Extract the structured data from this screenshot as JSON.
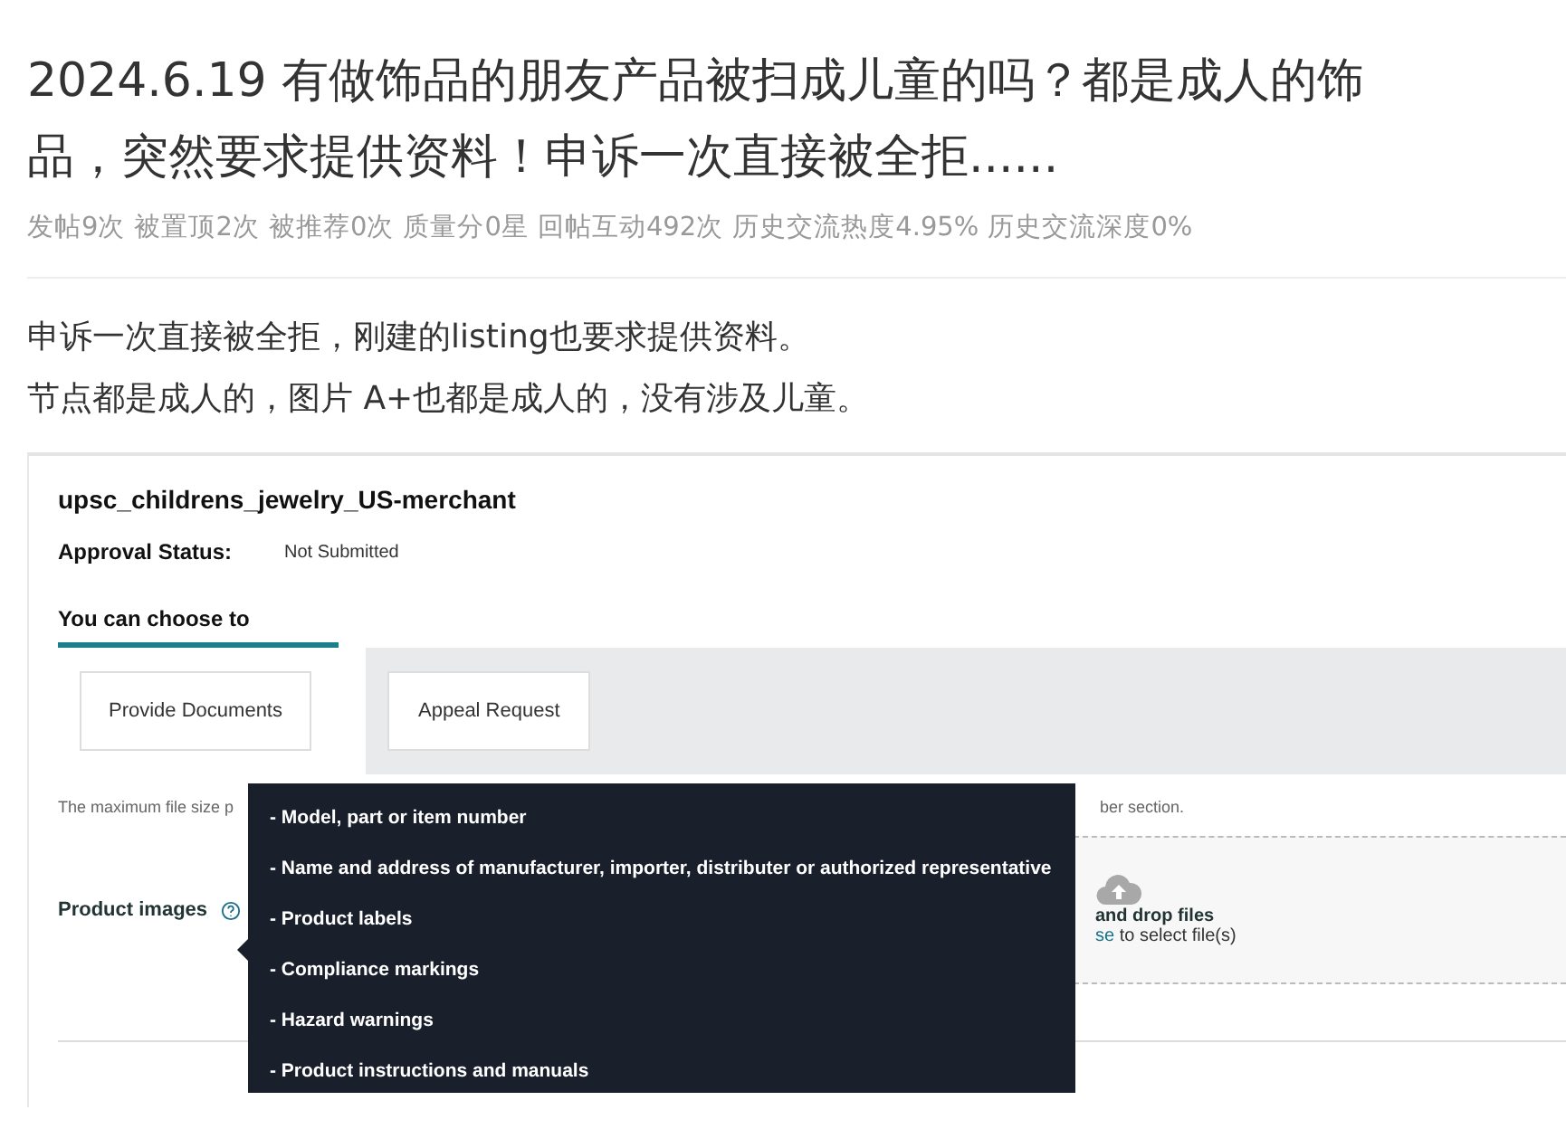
{
  "post": {
    "title": "2024.6.19 有做饰品的朋友产品被扫成儿童的吗？都是成人的饰品，突然要求提供资料！申诉一次直接被全拒......",
    "stats": [
      "发帖9次",
      "被置顶2次",
      "被推荐0次",
      "质量分0星",
      "回帖互动492次",
      "历史交流热度4.95%",
      "历史交流深度0%"
    ],
    "body": [
      "申诉一次直接被全拒，刚建的listing也要求提供资料。",
      "节点都是成人的，图片 A+也都是成人的，没有涉及儿童。"
    ]
  },
  "screenshot": {
    "title": "upsc_childrens_jewelry_US-merchant",
    "approval_label": "Approval Status:",
    "approval_value": "Not Submitted",
    "choose_label": "You can choose to",
    "options": [
      {
        "label": "Provide Documents",
        "selected": true
      },
      {
        "label": "Appeal Request",
        "selected": false
      }
    ],
    "note_left": "The maximum file size p",
    "note_right": "ber section.",
    "field_label": "Product images",
    "dropzone": {
      "title": "and drop files",
      "link": "se",
      "rest": " to select file(s)"
    },
    "tooltip": [
      "- Model, part or item number",
      "- Name and address of manufacturer, importer, distributer or authorized representative",
      "- Product labels",
      "- Compliance markings",
      "- Hazard warnings",
      "- Product instructions and manuals"
    ]
  }
}
